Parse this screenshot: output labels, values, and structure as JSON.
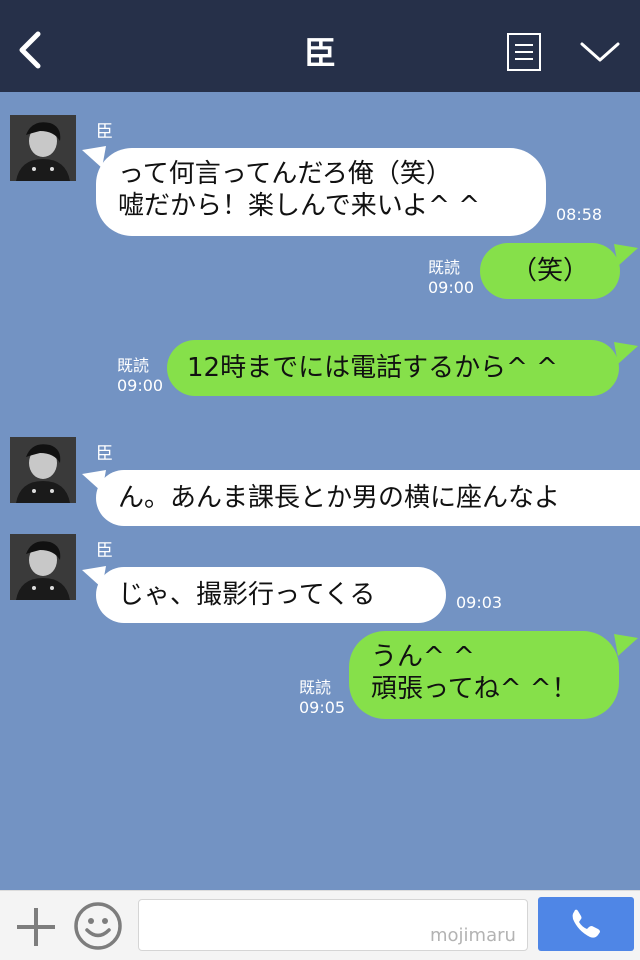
{
  "header": {
    "title": "臣"
  },
  "messages": [
    {
      "type": "received",
      "sender": "臣",
      "lines": [
        "って何言ってんだろ俺（笑）",
        "嘘だから！楽しんで来いよ^ ^"
      ],
      "time": "08:58"
    },
    {
      "type": "sent",
      "read": "既読",
      "time": "09:00",
      "lines": [
        "（笑）"
      ]
    },
    {
      "type": "sent",
      "read": "既読",
      "time": "09:00",
      "lines": [
        "12時までには電話するから^ ^"
      ]
    },
    {
      "type": "received",
      "sender": "臣",
      "lines": [
        "ん。あんま課長とか男の横に座んなよ"
      ]
    },
    {
      "type": "received",
      "sender": "臣",
      "lines": [
        "じゃ、撮影行ってくる"
      ],
      "time": "09:03"
    },
    {
      "type": "sent",
      "read": "既読",
      "time": "09:05",
      "lines": [
        "うん^ ^",
        "頑張ってね^ ^！"
      ]
    }
  ],
  "footer": {
    "input_value": "",
    "watermark": "mojimaru"
  },
  "colors": {
    "background": "#7393c3",
    "header": "#263049",
    "sent_bubble": "#86e04a",
    "received_bubble": "#ffffff",
    "send_button": "#4f86e6"
  },
  "icons": [
    "back-icon",
    "menu-icon",
    "chevron-down-icon",
    "plus-icon",
    "emoji-icon",
    "phone-icon"
  ]
}
